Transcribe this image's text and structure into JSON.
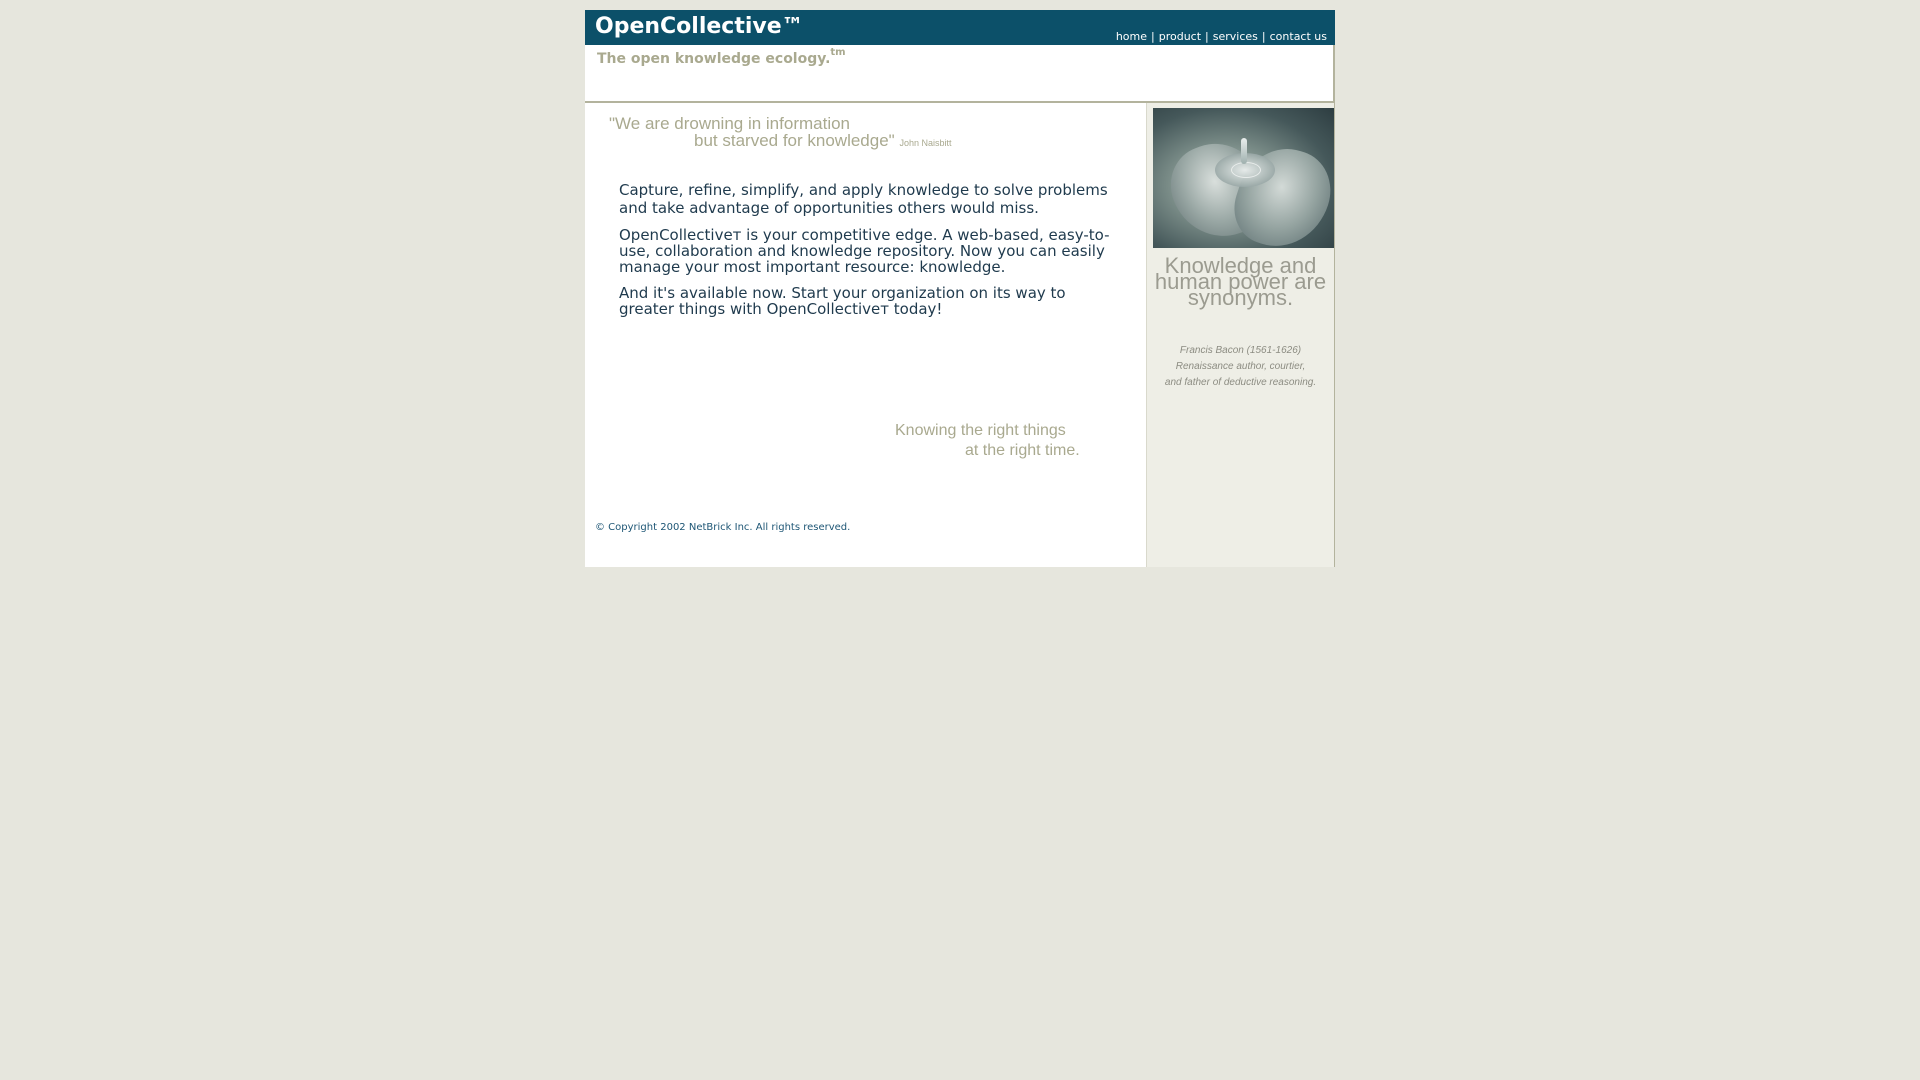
{
  "header": {
    "logo": "OpenCollective™",
    "tagline": "The open knowledge ecology.",
    "tagline_sup": "tm",
    "nav": [
      {
        "label": "home"
      },
      {
        "label": "product"
      },
      {
        "label": "services"
      },
      {
        "label": "contact us"
      }
    ],
    "nav_separator": "|",
    "bar_color": "#0c5069"
  },
  "main": {
    "quote_line1": "\"We are drowning in information",
    "quote_line2": "but starved for knowledge\"",
    "quote_author": "John Naisbitt",
    "paragraphs": [
      "Capture, refine, simplify, and apply knowledge to solve problems and take advantage of opportunities others would miss.",
      "OpenCollectiveт is your competitive edge. A web-based, easy-to-use, collaboration and knowledge repository. Now you can easily manage your most important resource: knowledge.",
      "And it's available now. Start your organization on its way to greater things with OpenCollectiveт today!"
    ],
    "knowing_line1": "Knowing the right things",
    "knowing_line2": "at the right time.",
    "copyright": "© Copyright 2002 NetBrick Inc. All rights reserved."
  },
  "sidebar": {
    "photo_icon": "hands-water-photo",
    "quote": "Knowledge and human power are synonyms.",
    "attribution_line1": "Francis Bacon (1561-1626)",
    "attribution_line2": "Renaissance author, courtier,",
    "attribution_line3": "and father of deductive reasoning."
  }
}
